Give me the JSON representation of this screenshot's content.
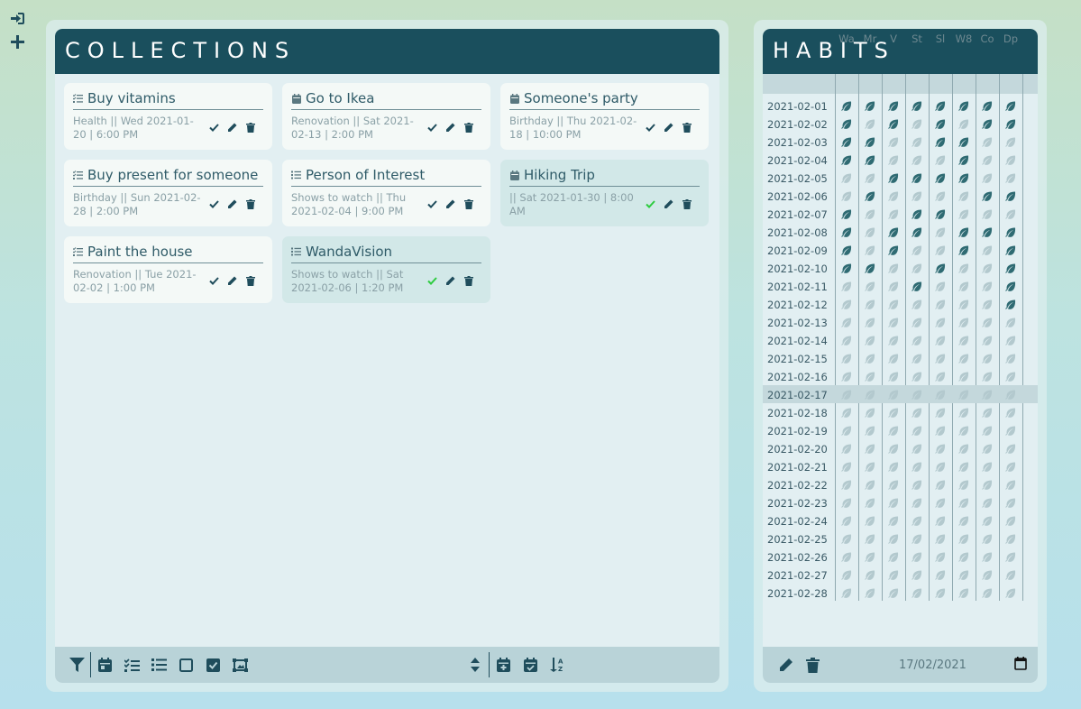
{
  "sidebar": {
    "icons": [
      "sign-in-icon",
      "plus-icon"
    ]
  },
  "collections": {
    "title": "Collections",
    "cards": [
      {
        "title": "Buy vitamins",
        "type": "task",
        "meta": "Health || Wed 2021-01-20 | 6:00 PM",
        "done": false
      },
      {
        "title": "Go to Ikea",
        "type": "event",
        "meta": "Renovation || Sat 2021-02-13 | 2:00 PM",
        "done": false
      },
      {
        "title": "Someone's party",
        "type": "event",
        "meta": "Birthday || Thu 2021-02-18 | 10:00 PM",
        "done": false
      },
      {
        "title": "Buy present for someone",
        "type": "task",
        "meta": "Birthday || Sun 2021-02-28 | 2:00 PM",
        "done": false
      },
      {
        "title": "Person of Interest",
        "type": "list",
        "meta": "Shows to watch || Thu 2021-02-04 | 9:00 PM",
        "done": false
      },
      {
        "title": "Hiking Trip",
        "type": "event",
        "meta": "|| Sat 2021-01-30 | 8:00 AM",
        "done": true
      },
      {
        "title": "Paint the house",
        "type": "task",
        "meta": "Renovation || Tue 2021-02-02 | 1:00 PM",
        "done": false
      },
      {
        "title": "WandaVision",
        "type": "list",
        "meta": "Shows to watch || Sat 2021-02-06 | 1:20 PM",
        "done": true
      }
    ],
    "footer_left": [
      "filter-icon",
      "calendar-icon",
      "tasks-icon",
      "list-icon",
      "square-icon",
      "check-square-icon",
      "image-icon"
    ],
    "footer_right": [
      "sort-icon",
      "calendar-plus-icon",
      "calendar-check-icon",
      "sort-alpha-icon"
    ]
  },
  "habits": {
    "title": "Habits",
    "columns": [
      "Wa",
      "Mr",
      "V",
      "St",
      "Sl",
      "W8",
      "Co",
      "Dp"
    ],
    "selected_row": "2021-02-17",
    "rows": [
      {
        "date": "2021-02-01",
        "marks": [
          1,
          1,
          1,
          1,
          1,
          1,
          1,
          1
        ]
      },
      {
        "date": "2021-02-02",
        "marks": [
          1,
          0,
          1,
          0,
          1,
          0,
          1,
          1
        ]
      },
      {
        "date": "2021-02-03",
        "marks": [
          1,
          1,
          0,
          0,
          1,
          1,
          0,
          0
        ]
      },
      {
        "date": "2021-02-04",
        "marks": [
          1,
          1,
          0,
          0,
          0,
          1,
          0,
          0
        ]
      },
      {
        "date": "2021-02-05",
        "marks": [
          0,
          0,
          1,
          1,
          1,
          1,
          0,
          0
        ]
      },
      {
        "date": "2021-02-06",
        "marks": [
          0,
          1,
          0,
          0,
          0,
          0,
          1,
          1
        ]
      },
      {
        "date": "2021-02-07",
        "marks": [
          1,
          0,
          0,
          1,
          1,
          0,
          0,
          0
        ]
      },
      {
        "date": "2021-02-08",
        "marks": [
          1,
          0,
          1,
          1,
          0,
          1,
          1,
          1
        ]
      },
      {
        "date": "2021-02-09",
        "marks": [
          1,
          0,
          1,
          0,
          0,
          1,
          0,
          1
        ]
      },
      {
        "date": "2021-02-10",
        "marks": [
          1,
          1,
          0,
          0,
          1,
          0,
          0,
          1
        ]
      },
      {
        "date": "2021-02-11",
        "marks": [
          0,
          0,
          0,
          1,
          0,
          0,
          0,
          1
        ]
      },
      {
        "date": "2021-02-12",
        "marks": [
          0,
          0,
          0,
          0,
          0,
          0,
          0,
          1
        ]
      },
      {
        "date": "2021-02-13",
        "marks": [
          0,
          0,
          0,
          0,
          0,
          0,
          0,
          0
        ]
      },
      {
        "date": "2021-02-14",
        "marks": [
          0,
          0,
          0,
          0,
          0,
          0,
          0,
          0
        ]
      },
      {
        "date": "2021-02-15",
        "marks": [
          0,
          0,
          0,
          0,
          0,
          0,
          0,
          0
        ]
      },
      {
        "date": "2021-02-16",
        "marks": [
          0,
          0,
          0,
          0,
          0,
          0,
          0,
          0
        ]
      },
      {
        "date": "2021-02-17",
        "marks": [
          0,
          0,
          0,
          0,
          0,
          0,
          0,
          0
        ]
      },
      {
        "date": "2021-02-18",
        "marks": [
          0,
          0,
          0,
          0,
          0,
          0,
          0,
          0
        ]
      },
      {
        "date": "2021-02-19",
        "marks": [
          0,
          0,
          0,
          0,
          0,
          0,
          0,
          0
        ]
      },
      {
        "date": "2021-02-20",
        "marks": [
          0,
          0,
          0,
          0,
          0,
          0,
          0,
          0
        ]
      },
      {
        "date": "2021-02-21",
        "marks": [
          0,
          0,
          0,
          0,
          0,
          0,
          0,
          0
        ]
      },
      {
        "date": "2021-02-22",
        "marks": [
          0,
          0,
          0,
          0,
          0,
          0,
          0,
          0
        ]
      },
      {
        "date": "2021-02-23",
        "marks": [
          0,
          0,
          0,
          0,
          0,
          0,
          0,
          0
        ]
      },
      {
        "date": "2021-02-24",
        "marks": [
          0,
          0,
          0,
          0,
          0,
          0,
          0,
          0
        ]
      },
      {
        "date": "2021-02-25",
        "marks": [
          0,
          0,
          0,
          0,
          0,
          0,
          0,
          0
        ]
      },
      {
        "date": "2021-02-26",
        "marks": [
          0,
          0,
          0,
          0,
          0,
          0,
          0,
          0
        ]
      },
      {
        "date": "2021-02-27",
        "marks": [
          0,
          0,
          0,
          0,
          0,
          0,
          0,
          0
        ]
      },
      {
        "date": "2021-02-28",
        "marks": [
          0,
          0,
          0,
          0,
          0,
          0,
          0,
          0
        ]
      }
    ],
    "footer": {
      "date_value": "17/02/2021",
      "icons": [
        "pencil-icon",
        "trash-icon",
        "calendar-icon"
      ]
    }
  },
  "colors": {
    "header": "#1a4f5d",
    "icon": "#1f4d5c",
    "done_check": "#2ecc40",
    "leaf_on": "#2f6b73",
    "leaf_off": "#b3c9ce"
  }
}
